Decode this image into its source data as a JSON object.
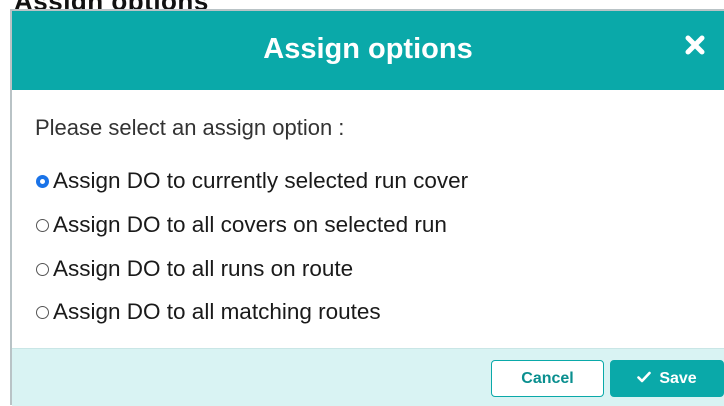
{
  "background": {
    "partial_text": "Assign options"
  },
  "dialog": {
    "title": "Assign options",
    "close_icon": "close-icon",
    "prompt": "Please select an assign option :",
    "options": [
      {
        "label": "Assign DO to currently selected run cover",
        "checked": true
      },
      {
        "label": "Assign DO to all covers on selected run",
        "checked": false
      },
      {
        "label": "Assign DO to all runs on route",
        "checked": false
      },
      {
        "label": "Assign DO to all matching routes",
        "checked": false
      }
    ],
    "buttons": {
      "cancel_label": "Cancel",
      "save_label": "Save",
      "save_icon": "check-icon"
    }
  },
  "colors": {
    "header": "#0aa9a9",
    "footer": "#d9f3f3",
    "radio_selected": "#1a73e8"
  }
}
